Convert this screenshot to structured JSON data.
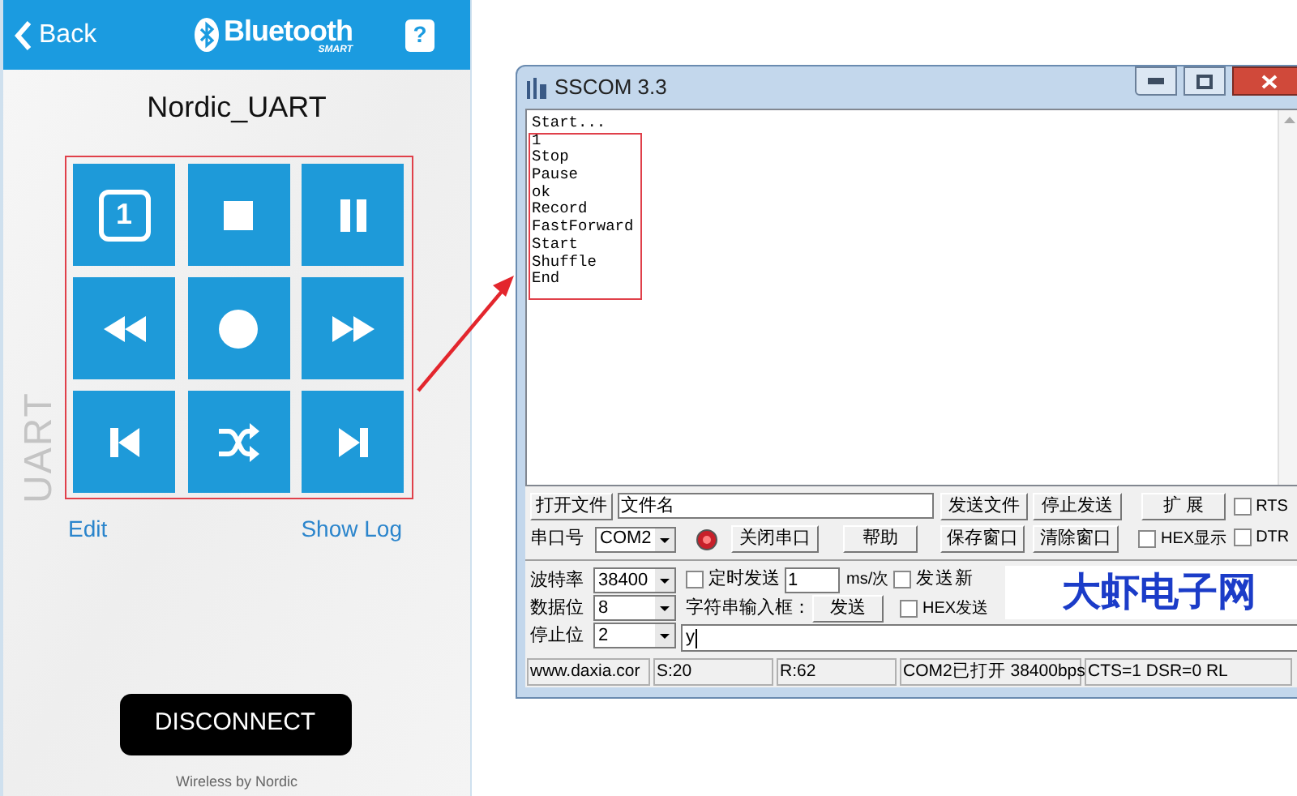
{
  "phone": {
    "back": "Back",
    "brand": "Bluetooth",
    "brand_sub": "SMART",
    "help": "?",
    "device": "Nordic_UART",
    "side_label": "UART",
    "buttons": [
      {
        "kind": "number",
        "label": "1"
      },
      {
        "kind": "stop"
      },
      {
        "kind": "pause"
      },
      {
        "kind": "rewind"
      },
      {
        "kind": "record"
      },
      {
        "kind": "fastforward"
      },
      {
        "kind": "previous"
      },
      {
        "kind": "shuffle"
      },
      {
        "kind": "next"
      }
    ],
    "links": [
      "Edit",
      "Show Log"
    ],
    "disconnect": "DISCONNECT",
    "footer": "Wireless by Nordic"
  },
  "sscom": {
    "title": "SSCOM 3.3",
    "log": [
      "Start...",
      "1",
      "Stop",
      "Pause",
      "ok",
      "Record",
      "FastForward",
      "Start",
      "Shuffle",
      "End"
    ],
    "open_file": "打开文件",
    "file_name": "文件名",
    "send_file": "发送文件",
    "stop_send": "停止发送",
    "expand": "扩 展",
    "rts": {
      "label": "RTS",
      "checked": false
    },
    "dtr": {
      "label": "DTR",
      "checked": false
    },
    "port_label": "串口号",
    "port": "COM2",
    "port_open": true,
    "close_port": "关闭串口",
    "help": "帮助",
    "save_window": "保存窗口",
    "clear_window": "清除窗口",
    "hex_display": {
      "label": "HEX显示",
      "checked": false
    },
    "settings": [
      {
        "label": "波特率",
        "value": "38400"
      },
      {
        "label": "数据位",
        "value": "8"
      },
      {
        "label": "停止位",
        "value": "2"
      }
    ],
    "timed_send": {
      "label": "定时发送",
      "checked": false
    },
    "interval": "1",
    "interval_unit": "ms/次",
    "send_newline": {
      "label": "发送新",
      "checked": false
    },
    "input_label": "字符串输入框：",
    "send": "发送",
    "hex_send": {
      "label": "HEX发送",
      "checked": false
    },
    "banner": "大虾电子网",
    "input": "y",
    "status": [
      "www.daxia.cor",
      "S:20",
      "R:62",
      "COM2已打开 38400bps",
      "CTS=1 DSR=0 RL"
    ]
  }
}
